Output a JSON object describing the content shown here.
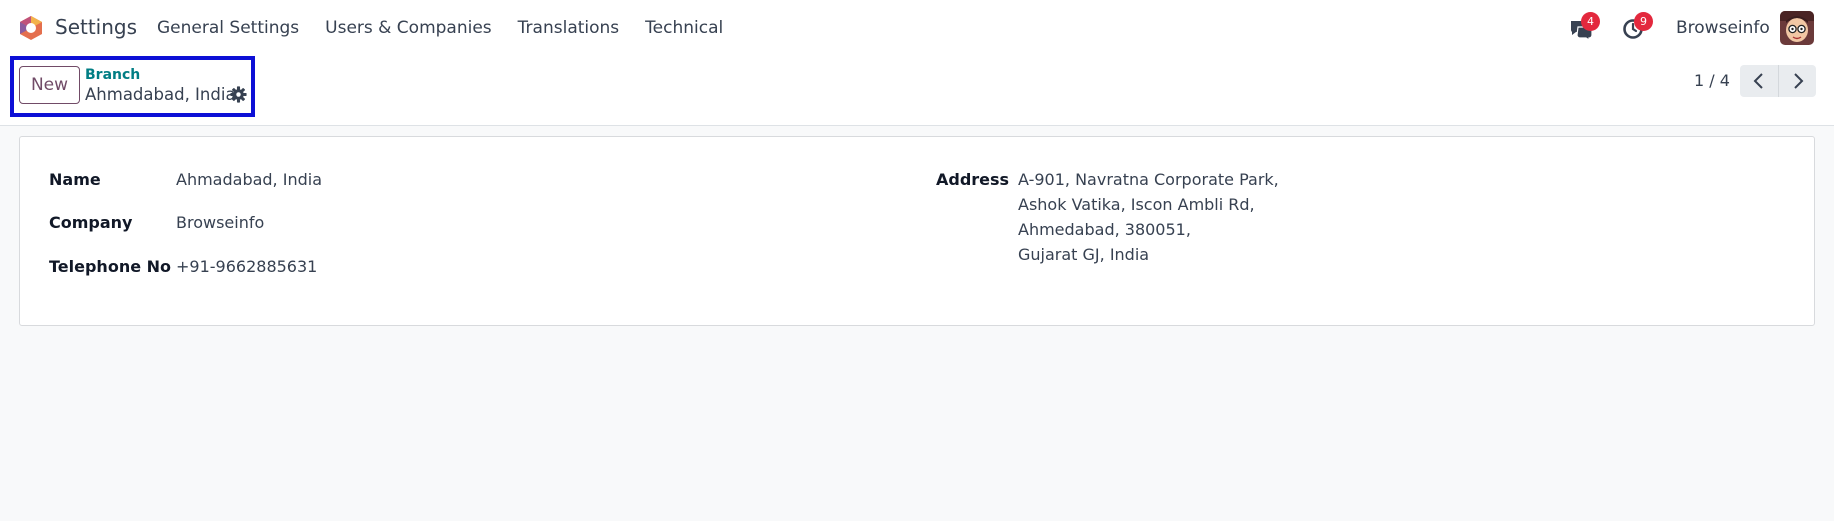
{
  "navbar": {
    "app_name": "Settings",
    "menu": [
      {
        "label": "General Settings"
      },
      {
        "label": "Users & Companies"
      },
      {
        "label": "Translations"
      },
      {
        "label": "Technical"
      }
    ],
    "messages_badge": "4",
    "activities_badge": "9",
    "user_name": "Browseinfo",
    "icons": {
      "logo": "odoo-logo-icon",
      "messages": "chat-bubbles-icon",
      "activities": "clock-icon",
      "avatar": "user-avatar"
    }
  },
  "control_panel": {
    "new_button": "New",
    "breadcrumb": "Branch",
    "record_title": "Ahmadabad, India",
    "pager_value": "1 / 4",
    "icons": {
      "actions": "gear-icon",
      "prev": "chevron-left-icon",
      "next": "chevron-right-icon"
    }
  },
  "form": {
    "name_label": "Name",
    "name_value": "Ahmadabad, India",
    "company_label": "Company",
    "company_value": "Browseinfo",
    "telephone_label": "Telephone No",
    "telephone_value": "+91-9662885631",
    "address_label": "Address",
    "address_lines": [
      "A-901, Navratna Corporate Park,",
      "Ashok Vatika, Iscon Ambli Rd,",
      "Ahmedabad, 380051,",
      "Gujarat GJ, India"
    ]
  },
  "colors": {
    "brand": "#714b67",
    "link": "#017e84",
    "badge": "#e3283d",
    "highlight": "#0d0fd6"
  }
}
